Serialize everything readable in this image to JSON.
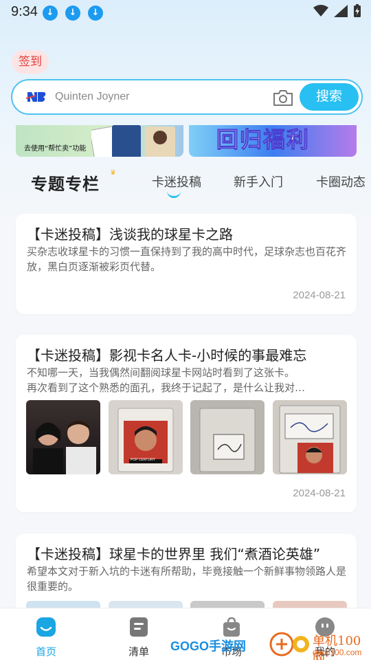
{
  "status": {
    "time": "9:34"
  },
  "signin_label": "签到",
  "search": {
    "placeholder": "Quinten Joyner",
    "button": "搜索"
  },
  "banners": {
    "left_text": "去使用“帮忙卖”功能",
    "right_text": "回归福利"
  },
  "tabs": {
    "title": "专题专栏",
    "items": [
      "卡迷投稿",
      "新手入门",
      "卡圈动态"
    ]
  },
  "articles": [
    {
      "title": "【卡迷投稿】浅谈我的球星卡之路",
      "desc": "买杂志收球星卡的习惯一直保持到了我的高中时代，足球杂志也百花齐放，黑白页逐渐被彩页代替。",
      "date": "2024-08-21"
    },
    {
      "title": "【卡迷投稿】影视卡名人卡-小时候的事最难忘",
      "desc1": "不知哪一天，当我偶然间翻阅球星卡网站时看到了这张卡。",
      "desc2": "再次看到了这个熟悉的面孔，我终于记起了，是什么让我对…",
      "date": "2024-08-21",
      "thumb_card_text": "POP CENTURY"
    },
    {
      "title": "【卡迷投稿】球星卡的世界里 我们“煮酒论英雄”",
      "desc": "希望本文对于新入坑的卡迷有所帮助，毕竟接触一个新鲜事物领路人是很重要的。"
    }
  ],
  "nav": {
    "home": "首页",
    "list": "清单",
    "center": "市场",
    "mine": "我的"
  },
  "watermark": {
    "left": "GOGO手游网",
    "right_top": "单机100网",
    "right_bottom": "danji100.com"
  },
  "colors": {
    "accent": "#28c0f2",
    "signin_bg": "#fde4e4",
    "signin_text": "#e2413c"
  }
}
